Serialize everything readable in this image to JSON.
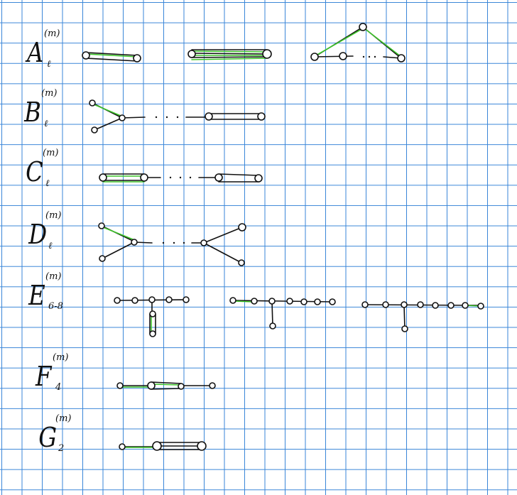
{
  "labels": {
    "A": {
      "letter": "A",
      "sup": "(m)",
      "sub": "ℓ"
    },
    "B": {
      "letter": "B",
      "sup": "(m)",
      "sub": "ℓ"
    },
    "C": {
      "letter": "C",
      "sup": "(m)",
      "sub": "ℓ"
    },
    "D": {
      "letter": "D",
      "sup": "(m)",
      "sub": "ℓ"
    },
    "E": {
      "letter": "E",
      "sup": "(m)",
      "sub": "6-8"
    },
    "F": {
      "letter": "F",
      "sup": "(m)",
      "sub": "4"
    },
    "G": {
      "letter": "G",
      "sup": "(m)",
      "sub": "2"
    }
  },
  "colors": {
    "grid": "#3a86d8",
    "ink": "#111111",
    "highlight": "#3ec42a"
  }
}
